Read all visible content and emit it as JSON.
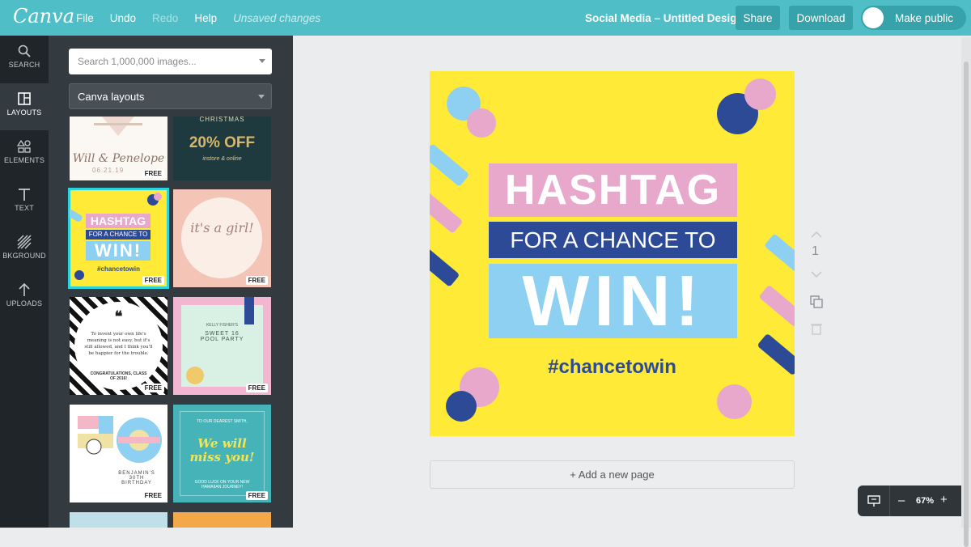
{
  "app": {
    "logo": "Canva"
  },
  "menu": {
    "file": "File",
    "undo": "Undo",
    "redo": "Redo",
    "help": "Help",
    "status": "Unsaved changes"
  },
  "header": {
    "doc_title": "Social Media – Untitled Design",
    "share": "Share",
    "download": "Download",
    "make_public": "Make public"
  },
  "rail": [
    {
      "label": "SEARCH",
      "icon": "search-icon"
    },
    {
      "label": "LAYOUTS",
      "icon": "layouts-icon"
    },
    {
      "label": "ELEMENTS",
      "icon": "elements-icon"
    },
    {
      "label": "TEXT",
      "icon": "text-icon"
    },
    {
      "label": "BKGROUND",
      "icon": "background-icon"
    },
    {
      "label": "UPLOADS",
      "icon": "upload-icon"
    }
  ],
  "panel": {
    "search_placeholder": "Search 1,000,000 images...",
    "select_value": "Canva layouts",
    "free_badge": "FREE",
    "thumbs": {
      "t1_text": "Will & Penelope",
      "t1_date": "06.21.19",
      "t2_title": "CHRISTMAS",
      "t2_offer": "20% OFF",
      "t2_sub": "instore & online",
      "t3_line1": "HASHTAG",
      "t3_line2": "FOR A CHANCE TO",
      "t3_line3": "WIN!",
      "t3_tag": "#chancetowin",
      "t4_text": "it's a girl!",
      "t5_quote": "To invent your own life's meaning is not easy, but it's still allowed, and I think you'll be happier for the trouble.",
      "t5_congrats": "CONGRATULATIONS, CLASS OF 2016!",
      "t6_top": "KELLY FISHER'S",
      "t6_title": "SWEET 16 POOL PARTY",
      "t7_name": "BENJAMIN'S 30TH BIRTHDAY",
      "t8_top": "TO OUR DEAREST SMITH,",
      "t8_title": "We will miss you!",
      "t8_sub": "GOOD LUCK ON YOUR NEW HAWAIIAN JOURNEY!"
    }
  },
  "design": {
    "line1": "HASHTAG",
    "line2": "FOR A CHANCE TO",
    "line3": "WIN!",
    "hashtag": "#chancetowin",
    "colors": {
      "bg": "#ffea37",
      "pink": "#e7a8cc",
      "navy": "#2d4a96",
      "sky": "#8ed0f2"
    }
  },
  "page": {
    "number": "1",
    "add_page": "+ Add a new page"
  },
  "zoom": {
    "value": "67%",
    "minus": "–",
    "plus": "+"
  }
}
